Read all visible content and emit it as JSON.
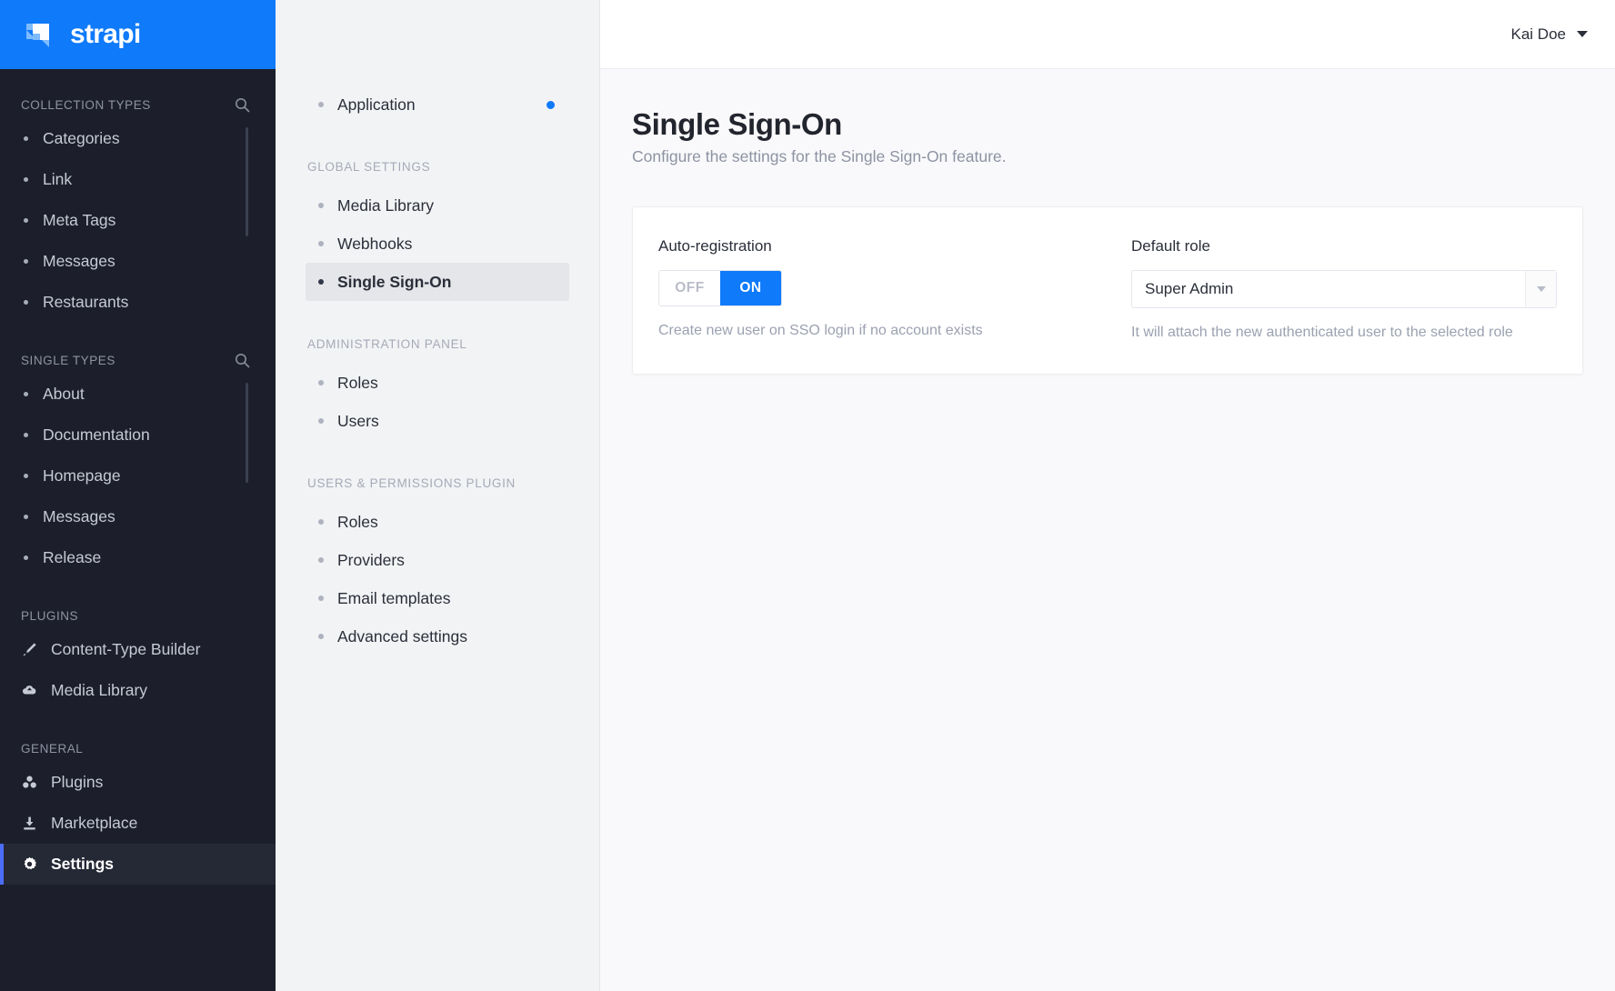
{
  "brand": {
    "name": "strapi",
    "logo_icon": "strapi-logo-mark",
    "accent_color": "#0f7afa"
  },
  "topbar": {
    "user_name": "Kai Doe",
    "caret_icon": "chevron-down-icon"
  },
  "sidebar": {
    "sections": [
      {
        "title": "COLLECTION TYPES",
        "search_icon": "search-icon",
        "items": [
          {
            "label": "Categories"
          },
          {
            "label": "Link"
          },
          {
            "label": "Meta Tags"
          },
          {
            "label": "Messages"
          },
          {
            "label": "Restaurants"
          }
        ]
      },
      {
        "title": "SINGLE TYPES",
        "search_icon": "search-icon",
        "items": [
          {
            "label": "About"
          },
          {
            "label": "Documentation"
          },
          {
            "label": "Homepage"
          },
          {
            "label": "Messages"
          },
          {
            "label": "Release"
          }
        ]
      },
      {
        "title": "PLUGINS",
        "items": [
          {
            "label": "Content-Type Builder",
            "icon": "paint-brush-icon"
          },
          {
            "label": "Media Library",
            "icon": "cloud-upload-icon"
          }
        ]
      },
      {
        "title": "GENERAL",
        "items": [
          {
            "label": "Plugins",
            "icon": "puzzle-icon"
          },
          {
            "label": "Marketplace",
            "icon": "download-icon"
          },
          {
            "label": "Settings",
            "icon": "gear-icon",
            "active": true
          }
        ]
      }
    ]
  },
  "subnav": {
    "top_items": [
      {
        "label": "Application",
        "badge": true
      }
    ],
    "sections": [
      {
        "title": "GLOBAL SETTINGS",
        "items": [
          {
            "label": "Media Library"
          },
          {
            "label": "Webhooks"
          },
          {
            "label": "Single Sign-On",
            "active": true
          }
        ]
      },
      {
        "title": "ADMINISTRATION PANEL",
        "items": [
          {
            "label": "Roles"
          },
          {
            "label": "Users"
          }
        ]
      },
      {
        "title": "USERS & PERMISSIONS PLUGIN",
        "items": [
          {
            "label": "Roles"
          },
          {
            "label": "Providers"
          },
          {
            "label": "Email templates"
          },
          {
            "label": "Advanced settings"
          }
        ]
      }
    ]
  },
  "page": {
    "title": "Single Sign-On",
    "subtitle": "Configure the settings for the Single Sign-On feature."
  },
  "form": {
    "auto_registration": {
      "label": "Auto-registration",
      "off_label": "OFF",
      "on_label": "ON",
      "value": "ON",
      "hint": "Create new user on SSO login if no account exists"
    },
    "default_role": {
      "label": "Default role",
      "value": "Super Admin",
      "hint": "It will attach the new authenticated user to the selected role",
      "arrow_icon": "chevron-down-icon"
    }
  }
}
